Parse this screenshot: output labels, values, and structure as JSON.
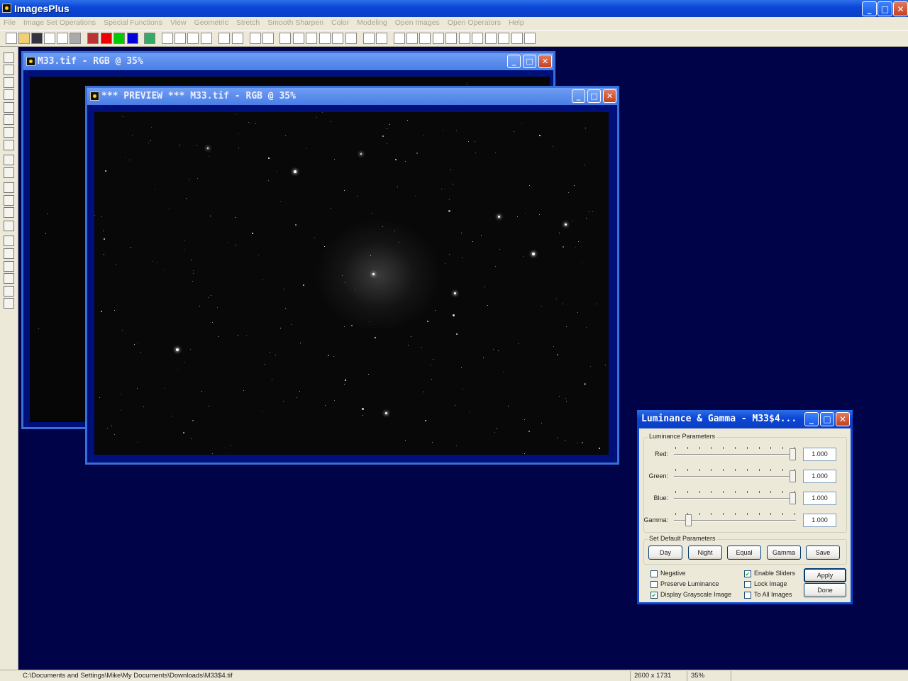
{
  "app": {
    "title": "ImagesPlus"
  },
  "menu": [
    "File",
    "Image Set Operations",
    "Special Functions",
    "View",
    "Geometric",
    "Stretch",
    "Smooth Sharpen",
    "Color",
    "Modeling",
    "Open Images",
    "Open Operators",
    "Help"
  ],
  "window_buttons": {
    "minimize": "_",
    "maximize": "□",
    "close": "✕"
  },
  "windows": {
    "original": {
      "title": "M33.tif - RGB @ 35%"
    },
    "preview": {
      "title": "*** PREVIEW *** M33.tif - RGB @ 35%"
    }
  },
  "dialog": {
    "title": "Luminance & Gamma - M33$4...",
    "luminance_group": "Luminance Parameters",
    "sliders": [
      {
        "label": "Red:",
        "value": "1.000",
        "level": 1.0
      },
      {
        "label": "Green:",
        "value": "1.000",
        "level": 1.0
      },
      {
        "label": "Blue:",
        "value": "1.000",
        "level": 1.0
      },
      {
        "label": "Gamma:",
        "value": "1.000",
        "level": 0.1
      }
    ],
    "defaults_group": "Set Default Parameters",
    "preset_buttons": [
      "Day",
      "Night",
      "Equal",
      "Gamma",
      "Save"
    ],
    "checkboxes_left": [
      {
        "label": "Negative",
        "checked": false
      },
      {
        "label": "Preserve Luminance",
        "checked": false
      },
      {
        "label": "Display Grayscale Image",
        "checked": true
      }
    ],
    "checkboxes_right": [
      {
        "label": "Enable Sliders",
        "checked": true
      },
      {
        "label": "Lock Image",
        "checked": false
      },
      {
        "label": "To All Images",
        "checked": false
      }
    ],
    "apply_label": "Apply",
    "done_label": "Done"
  },
  "status": {
    "path": "C:\\Documents and Settings\\Mike\\My Documents\\Downloads\\M33$4.tif",
    "dimensions": "2600 x 1731",
    "zoom": "35%"
  },
  "colors": {
    "workspace": "#000347",
    "xp_title": "#0a46d6",
    "child_title": "#6f9df3"
  }
}
